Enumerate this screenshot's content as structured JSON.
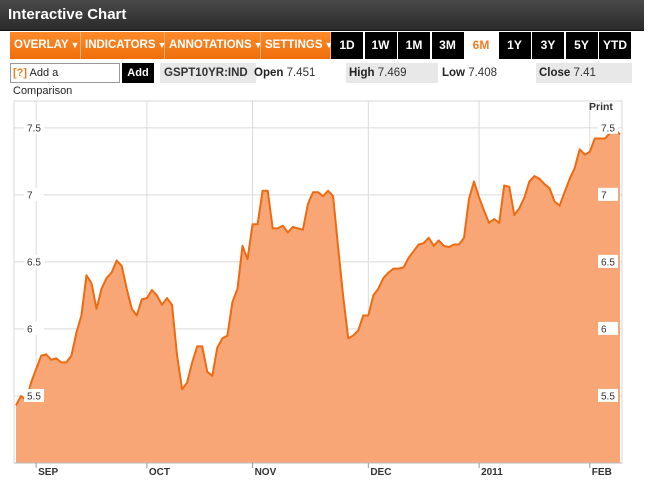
{
  "title": "Interactive Chart",
  "menu": {
    "overlay": "OVERLAY",
    "indicators": "INDICATORS",
    "annotations": "ANNOTATIONS",
    "settings": "SETTINGS",
    "caret": "▼"
  },
  "ranges": [
    "1D",
    "1W",
    "1M",
    "3M",
    "6M",
    "1Y",
    "3Y",
    "5Y",
    "YTD"
  ],
  "active_range": "6M",
  "compare": {
    "help": "[?]",
    "placeholder": "Add a Comparison",
    "add_label": "Add"
  },
  "ticker": "GSPT10YR:IND",
  "stats": {
    "open_label": "Open",
    "open": "7.451",
    "high_label": "High",
    "high": "7.469",
    "low_label": "Low",
    "low": "7.408",
    "close_label": "Close",
    "close": "7.41"
  },
  "print_label": "Print",
  "colors": {
    "accent": "#ef7d22",
    "area_fill": "#f9a676",
    "line": "#ee6a10"
  },
  "chart_data": {
    "type": "area",
    "ylim": [
      5.0,
      7.7
    ],
    "y_ticks": [
      "5.5",
      "6",
      "6.5",
      "7",
      "7.5"
    ],
    "x_ticks": [
      {
        "label": "SEP",
        "index": 4
      },
      {
        "label": "OCT",
        "index": 26
      },
      {
        "label": "NOV",
        "index": 47
      },
      {
        "label": "DEC",
        "index": 70
      },
      {
        "label": "2011",
        "index": 92
      },
      {
        "label": "FEB",
        "index": 114
      }
    ],
    "grid": true,
    "series": [
      {
        "values": [
          5.43,
          5.5,
          5.47,
          5.6,
          5.7,
          5.8,
          5.81,
          5.77,
          5.78,
          5.75,
          5.75,
          5.8,
          5.97,
          6.1,
          6.4,
          6.34,
          6.15,
          6.3,
          6.38,
          6.42,
          6.51,
          6.47,
          6.3,
          6.15,
          6.1,
          6.22,
          6.23,
          6.29,
          6.25,
          6.18,
          6.23,
          6.18,
          5.8,
          5.55,
          5.6,
          5.75,
          5.87,
          5.87,
          5.68,
          5.65,
          5.86,
          5.93,
          5.95,
          6.2,
          6.3,
          6.62,
          6.52,
          6.78,
          6.78,
          7.03,
          7.03,
          6.75,
          6.75,
          6.77,
          6.72,
          6.76,
          6.75,
          6.74,
          6.93,
          7.02,
          7.02,
          6.99,
          7.03,
          6.99,
          6.61,
          6.24,
          5.93,
          5.95,
          5.99,
          6.1,
          6.1,
          6.25,
          6.3,
          6.38,
          6.42,
          6.45,
          6.45,
          6.46,
          6.53,
          6.58,
          6.63,
          6.64,
          6.68,
          6.62,
          6.66,
          6.62,
          6.61,
          6.63,
          6.63,
          6.68,
          6.97,
          7.1,
          6.98,
          6.88,
          6.79,
          6.82,
          6.79,
          7.07,
          7.06,
          6.85,
          6.9,
          6.98,
          7.1,
          7.14,
          7.12,
          7.08,
          7.05,
          6.95,
          6.92,
          7.02,
          7.12,
          7.2,
          7.34,
          7.3,
          7.32,
          7.42,
          7.42,
          7.42,
          7.46,
          7.49,
          7.45
        ]
      }
    ]
  }
}
